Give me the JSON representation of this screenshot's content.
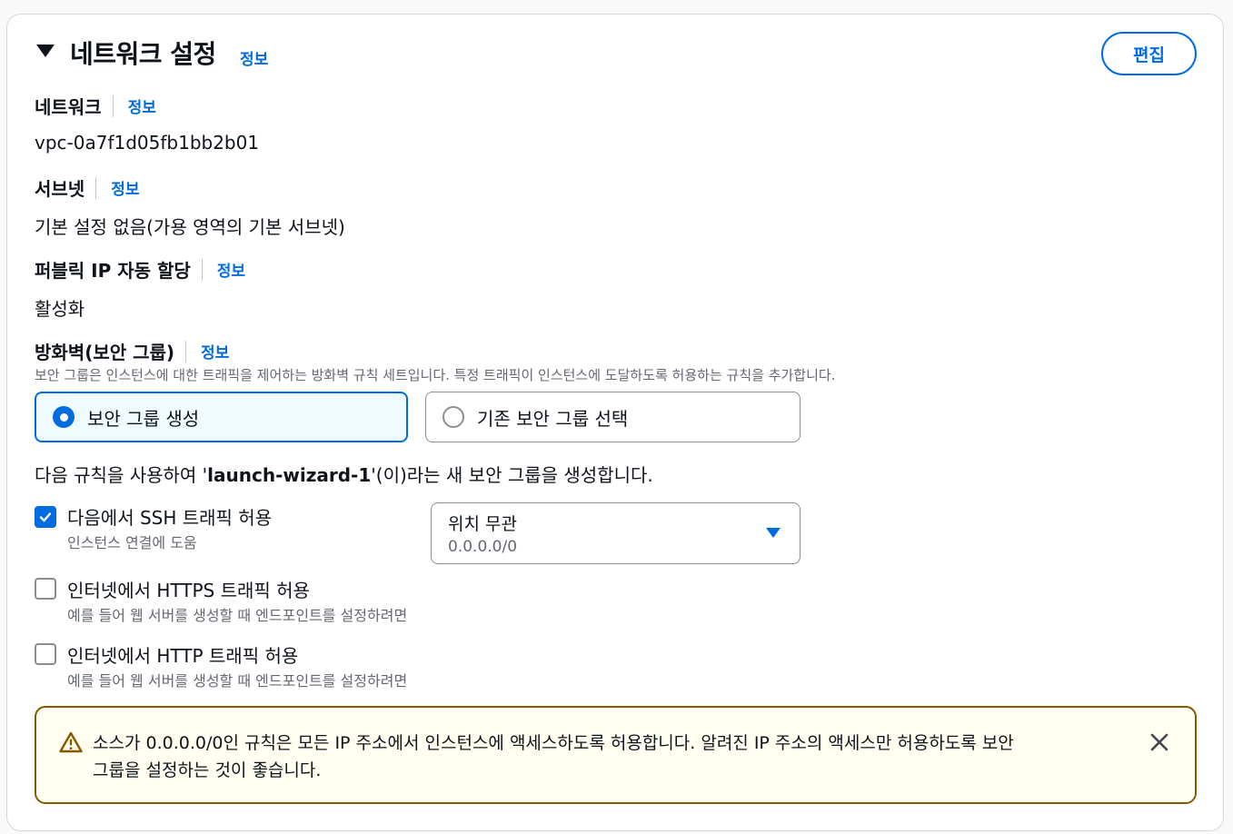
{
  "section": {
    "title": "네트워크 설정",
    "info_link": "정보",
    "edit_button": "편집"
  },
  "network": {
    "label": "네트워크",
    "info_link": "정보",
    "value": "vpc-0a7f1d05fb1bb2b01"
  },
  "subnet": {
    "label": "서브넷",
    "info_link": "정보",
    "value": "기본 설정 없음(가용 영역의 기본 서브넷)"
  },
  "public_ip": {
    "label": "퍼블릭 IP 자동 할당",
    "info_link": "정보",
    "value": "활성화"
  },
  "firewall": {
    "label": "방화벽(보안 그룹)",
    "info_link": "정보",
    "description": "보안 그룹은 인스턴스에 대한 트래픽을 제어하는 방화벽 규칙 세트입니다. 특정 트래픽이 인스턴스에 도달하도록 허용하는 규칙을 추가합니다.",
    "options": [
      {
        "label": "보안 그룹 생성",
        "selected": true
      },
      {
        "label": "기존 보안 그룹 선택",
        "selected": false
      }
    ],
    "rule_text_prefix": "다음 규칙을 사용하여 '",
    "rule_group_name": "launch-wizard-1",
    "rule_text_suffix": "'(이)라는 새 보안 그룹을 생성합니다."
  },
  "rules": [
    {
      "label": "다음에서 SSH 트래픽 허용",
      "description": "인스턴스 연결에 도움",
      "checked": true
    },
    {
      "label": "인터넷에서 HTTPS 트래픽 허용",
      "description": "예를 들어 웹 서버를 생성할 때 엔드포인트를 설정하려면",
      "checked": false
    },
    {
      "label": "인터넷에서 HTTP 트래픽 허용",
      "description": "예를 들어 웹 서버를 생성할 때 엔드포인트를 설정하려면",
      "checked": false
    }
  ],
  "source_select": {
    "value": "위치 무관",
    "sub": "0.0.0.0/0"
  },
  "warning": {
    "line1": "소스가 0.0.0.0/0인 규칙은 모든 IP 주소에서 인스턴스에 액세스하도록 허용합니다. 알려진 IP 주소의 액세스만 허용하도록 보안",
    "line2": "그룹을 설정하는 것이 좋습니다."
  },
  "colors": {
    "accent": "#006ce0",
    "warning_border": "#855900",
    "warning_bg": "#fffef0",
    "text": "#0f141a",
    "muted": "#656871"
  },
  "icons": {
    "collapse": "caret-down-icon",
    "check": "check-icon",
    "dropdown": "triangle-down-icon",
    "warning": "warning-triangle-icon",
    "close": "close-icon"
  }
}
